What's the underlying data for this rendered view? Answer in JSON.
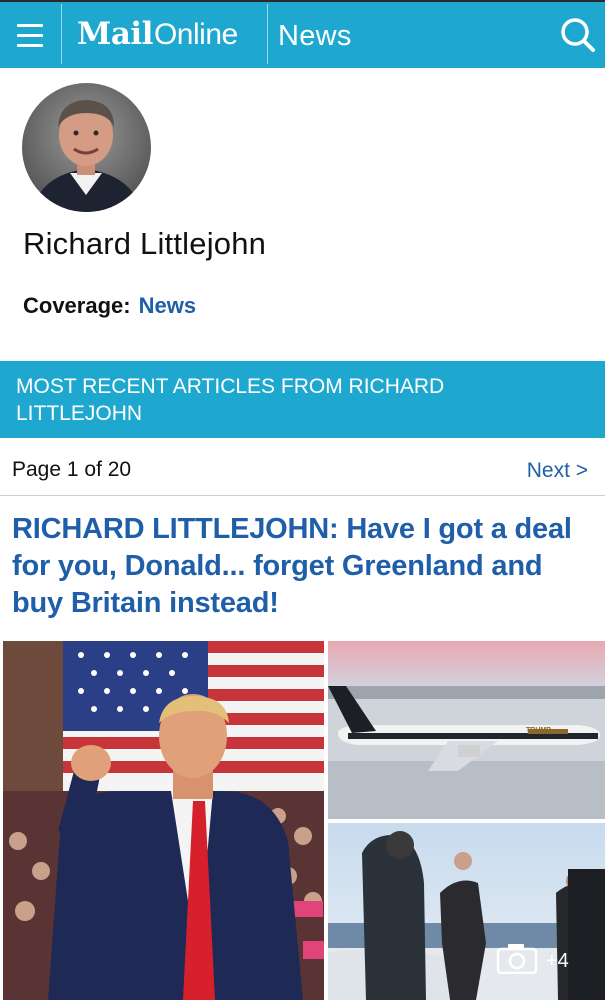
{
  "header": {
    "logo_mail": "Mail",
    "logo_online": "Online",
    "section": "News",
    "menu_icon": "hamburger-menu-icon",
    "search_icon": "search-icon",
    "bar_color": "#1fa8cf"
  },
  "author": {
    "name": "Richard Littlejohn",
    "coverage_label": "Coverage:",
    "coverage_value": "News"
  },
  "recent": {
    "heading_line1": "MOST RECENT ARTICLES FROM RICHARD",
    "heading_line2": "LITTLEJOHN"
  },
  "pager": {
    "page_text": "Page 1 of 20",
    "next_label": "Next >"
  },
  "article": {
    "headline": "RICHARD LITTLEJOHN: Have I got a deal for you, Donald... forget Greenland and buy Britain instead!",
    "plane_livery": "TRUMP",
    "photo_count_icon": "camera-icon",
    "photo_count": "+4"
  },
  "colors": {
    "link_blue": "#1f5ea8",
    "banner_cyan": "#1fa8cf"
  }
}
